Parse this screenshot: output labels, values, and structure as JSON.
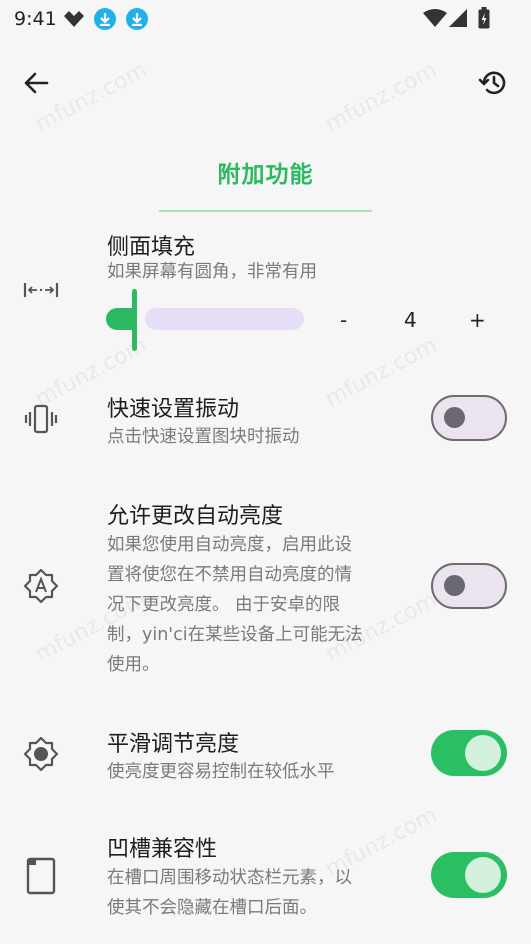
{
  "status_bar": {
    "time": "9:41"
  },
  "section_title": "附加功能",
  "side_padding": {
    "title": "侧面填充",
    "subtitle": "如果屏幕有圆角，非常有用",
    "value": "4",
    "minus": "-",
    "plus": "+"
  },
  "quick_settings_vibrate": {
    "title": "快速设置振动",
    "subtitle": "点击快速设置图块时振动",
    "enabled": false
  },
  "allow_auto_brightness": {
    "title": "允许更改自动亮度",
    "subtitle_lines": [
      "如果您使用自动亮度，启用此设",
      "置将使您在不禁用自动亮度的情",
      "况下更改亮度。 由于安卓的限",
      "制，yin'ci在某些设备上可能无法",
      "使用。"
    ],
    "enabled": false
  },
  "smooth_brightness": {
    "title": "平滑调节亮度",
    "subtitle": "使亮度更容易控制在较低水平",
    "enabled": true
  },
  "notch_compat": {
    "title": "凹槽兼容性",
    "subtitle_lines": [
      "在槽口周围移动状态栏元素，以",
      "使其不会隐藏在槽口后面。"
    ],
    "enabled": true
  },
  "watermark": "mfunz.com",
  "colors": {
    "accent": "#2db862",
    "switch_on": "#2bbf63",
    "track": "#e6ddf7"
  }
}
